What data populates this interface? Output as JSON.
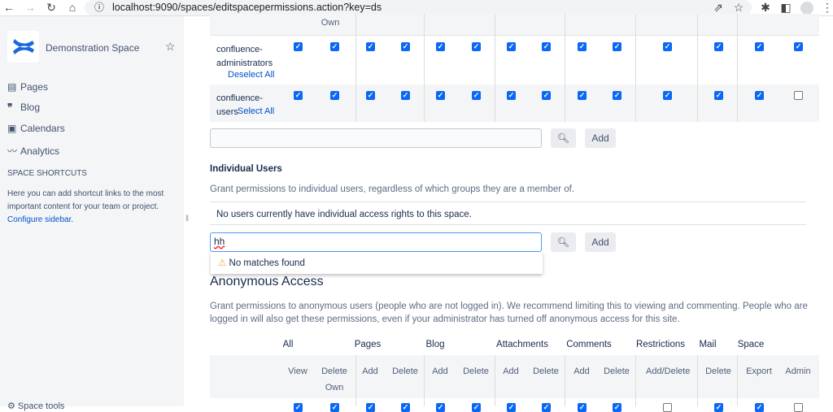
{
  "browser": {
    "url": "localhost:9090/spaces/editspacepermissions.action?key=ds"
  },
  "sidebar": {
    "space_name": "Demonstration Space",
    "items": [
      {
        "label": "Pages",
        "icon": "page-icon"
      },
      {
        "label": "Blog",
        "icon": "quote-icon"
      },
      {
        "label": "Calendars",
        "icon": "calendar-icon"
      },
      {
        "label": "Analytics",
        "icon": "analytics-icon"
      }
    ],
    "shortcuts_heading": "SPACE SHORTCUTS",
    "shortcuts_text": "Here you can add shortcut links to the most important content for your team or project.",
    "configure_link": "Configure sidebar.",
    "space_tools": "Space tools"
  },
  "groups": {
    "header_fragment": "Own",
    "rows": [
      {
        "name": "confluence-administrators",
        "action": "Deselect All",
        "checks": [
          1,
          1,
          1,
          1,
          1,
          1,
          1,
          1,
          1,
          1,
          1,
          1,
          1,
          1
        ]
      },
      {
        "name": "confluence-users",
        "action": "Select All",
        "checks": [
          1,
          1,
          1,
          1,
          1,
          1,
          1,
          1,
          1,
          1,
          1,
          1,
          1,
          0
        ]
      }
    ],
    "add_label": "Add",
    "search_value": ""
  },
  "individual": {
    "heading": "Individual Users",
    "description": "Grant permissions to individual users, regardless of which groups they are a member of.",
    "empty": "No users currently have individual access rights to this space.",
    "search_value": "hh",
    "no_matches": "No matches found",
    "add_label": "Add"
  },
  "anonymous": {
    "heading": "Anonymous Access",
    "description": "Grant permissions to anonymous users (people who are not logged in). We recommend limiting this to viewing and commenting. People who are logged in will also get these permissions, even if your administrator has turned off anonymous access for this site.",
    "groups": [
      "All",
      "Pages",
      "Blog",
      "Attachments",
      "Comments",
      "Restrictions",
      "Mail",
      "Space"
    ],
    "columns": [
      "View",
      "Delete Own",
      "Add",
      "Delete",
      "Add",
      "Delete",
      "Add",
      "Delete",
      "Add",
      "Delete",
      "Add/Delete",
      "Delete",
      "Export",
      "Admin"
    ],
    "checks": [
      1,
      1,
      1,
      1,
      1,
      1,
      1,
      1,
      1,
      1,
      0,
      1,
      1,
      0
    ]
  }
}
